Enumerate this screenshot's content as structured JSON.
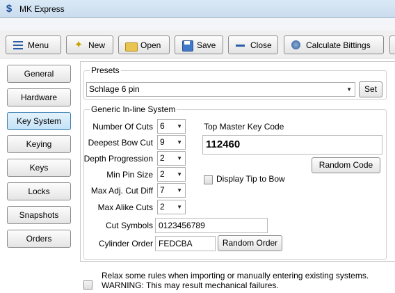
{
  "window": {
    "title": "MK Express"
  },
  "toolbar": {
    "menu": "Menu",
    "new": "New",
    "open": "Open",
    "save": "Save",
    "close": "Close",
    "calc": "Calculate Bittings"
  },
  "sidebar": {
    "items": [
      "General",
      "Hardware",
      "Key System",
      "Keying",
      "Keys",
      "Locks",
      "Snapshots",
      "Orders"
    ],
    "active": "Key System"
  },
  "presets": {
    "legend": "Presets",
    "selected": "Schlage 6 pin",
    "set_label": "Set"
  },
  "generic": {
    "legend": "Generic In-line System",
    "number_of_cuts": {
      "label": "Number Of Cuts",
      "value": "6"
    },
    "deepest_bow_cut": {
      "label": "Deepest Bow Cut",
      "value": "9"
    },
    "depth_progression": {
      "label": "Depth Progression",
      "value": "2"
    },
    "min_pin_size": {
      "label": "Min Pin Size",
      "value": "2"
    },
    "max_adj_cut_diff": {
      "label": "Max Adj. Cut Diff",
      "value": "7"
    },
    "max_alike_cuts": {
      "label": "Max Alike Cuts",
      "value": "2"
    },
    "cut_symbols": {
      "label": "Cut Symbols",
      "value": "0123456789"
    },
    "cylinder_order": {
      "label": "Cylinder Order",
      "value": "FEDCBA"
    },
    "random_order_label": "Random Order",
    "top_master_label": "Top Master Key Code",
    "top_master_value": "112460",
    "random_code_label": "Random Code",
    "display_tip_label": "Display Tip to Bow"
  },
  "relax": {
    "line1": "Relax some rules when importing or manually entering existing systems.",
    "line2": "WARNING: This may result mechanical failures."
  }
}
